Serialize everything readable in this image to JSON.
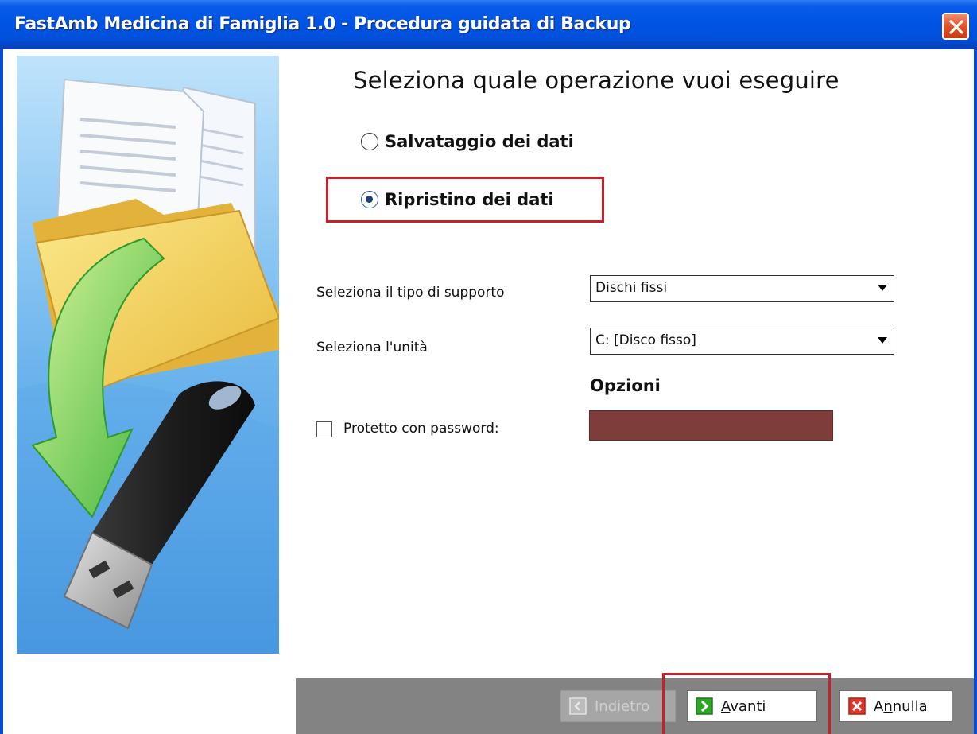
{
  "window": {
    "title": "FastAmb Medicina di Famiglia 1.0 - Procedura guidata di Backup"
  },
  "main": {
    "heading": "Seleziona quale operazione vuoi eseguire",
    "options": [
      {
        "label": "Salvataggio dei dati",
        "selected": false
      },
      {
        "label": "Ripristino dei dati",
        "selected": true
      }
    ],
    "support_type": {
      "label": "Seleziona il tipo di supporto",
      "value": "Dischi fissi"
    },
    "unit": {
      "label": "Seleziona l'unità",
      "value": "C: [Disco fisso]"
    },
    "options_title": "Opzioni",
    "password": {
      "label": "Protetto con password:",
      "checked": false,
      "value": ""
    }
  },
  "buttons": {
    "back": {
      "label": "Indietro",
      "enabled": false
    },
    "next": {
      "prefix": "",
      "mnemonic": "A",
      "rest": "vanti"
    },
    "cancel": {
      "prefix": "A",
      "mnemonic": "n",
      "rest": "nulla"
    }
  },
  "colors": {
    "titlebar": "#0054e3",
    "highlight": "#c8202a",
    "button_bar": "#838383",
    "password_fill": "#7e3d3a"
  },
  "icons": [
    "close-icon",
    "folder-icon",
    "document-icon",
    "arrow-icon",
    "usb-drive-icon",
    "back-arrow-icon",
    "next-arrow-icon",
    "cancel-x-icon"
  ]
}
